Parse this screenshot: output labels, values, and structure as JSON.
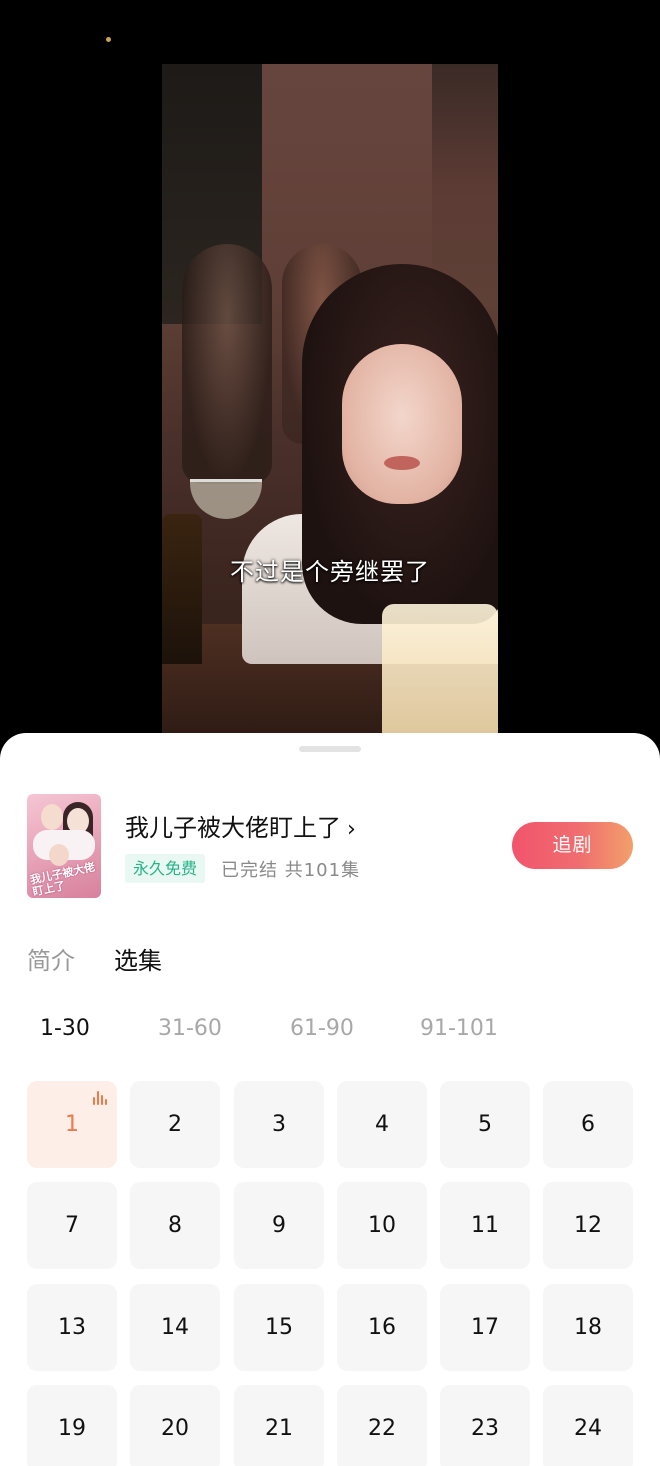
{
  "video": {
    "subtitle": "不过是个旁继罢了"
  },
  "show": {
    "title": "我儿子被大佬盯上了",
    "title_chevron": "›",
    "poster_text": "我儿子被大佬盯上了",
    "badge": "永久免费",
    "status": "已完结 共101集",
    "follow_label": "追剧"
  },
  "tabs": [
    {
      "label": "简介",
      "active": false
    },
    {
      "label": "选集",
      "active": true
    }
  ],
  "ranges": [
    {
      "label": "1-30",
      "active": true
    },
    {
      "label": "31-60",
      "active": false
    },
    {
      "label": "61-90",
      "active": false
    },
    {
      "label": "91-101",
      "active": false
    }
  ],
  "episodes": [
    "1",
    "2",
    "3",
    "4",
    "5",
    "6",
    "7",
    "8",
    "9",
    "10",
    "11",
    "12",
    "13",
    "14",
    "15",
    "16",
    "17",
    "18",
    "19",
    "20",
    "21",
    "22",
    "23",
    "24"
  ],
  "current_episode": "1",
  "colors": {
    "accent": "#f2784b",
    "follow_start": "#f2546c",
    "follow_end": "#f39f6a",
    "free_badge_text": "#28b488",
    "free_badge_bg": "#eaf8f3"
  },
  "icons": {
    "playing": "playing-bars-icon",
    "title_chevron": "chevron-right-icon"
  }
}
